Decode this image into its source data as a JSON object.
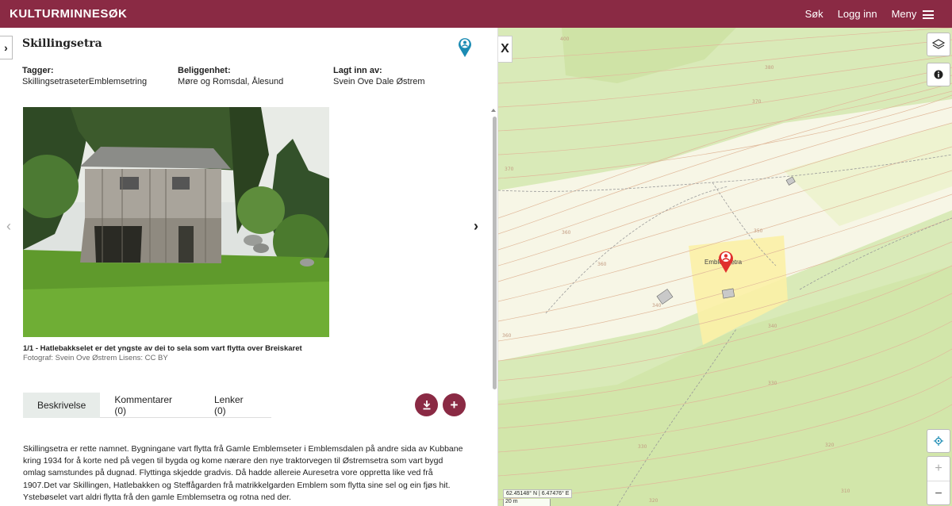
{
  "topbar": {
    "brand": "KULTURMINNESØK",
    "search_label": "Søk",
    "login_label": "Logg inn",
    "menu_label": "Meny",
    "bg_color": "#8a2a44"
  },
  "record": {
    "title": "Skillingsetra",
    "tags_label": "Tagger:",
    "tags_value": "SkillingsetraseterEmblemsetring",
    "location_label": "Beliggenhet:",
    "location_value": "Møre og Romsdal, Ålesund",
    "added_by_label": "Lagt inn av:",
    "added_by_value": "Svein Ove Dale Østrem"
  },
  "image": {
    "caption": "1/1 - Hatlebakkselet er det yngste av dei to sela som vart flytta over Breiskaret",
    "credit": "Fotograf: Svein Ove Østrem Lisens: CC BY"
  },
  "tabs": [
    {
      "label": "Beskrivelse",
      "active": true
    },
    {
      "label": "Kommentarer (0)",
      "active": false
    },
    {
      "label": "Lenker (0)",
      "active": false
    }
  ],
  "actions": {
    "download_icon": "download-icon",
    "add_icon": "plus-icon"
  },
  "description": "Skillingsetra er rette namnet. Bygningane vart flytta frå Gamle Emblemseter i Emblemsdalen på andre sida av Kubbane kring 1934 for å korte ned på vegen til bygda og kome nærare den nye traktorvegen til Østremsetra som vart bygd omlag samstundes på dugnad. Flyttinga skjedde gradvis. Då hadde allereie Auresetra vore oppretta like ved frå 1907.Det var Skillingen, Hatlebakken og Steffågarden frå matrikkelgarden Emblem som flytta sine sel og ein fjøs hit. Ystebøselet vart aldri flytta frå den gamle Emblemsetra og rotna ned der.",
  "map": {
    "site_label": "Emblemsetra",
    "coords": "62.45148° N | 6.47476° E",
    "scale": "20 m",
    "zoom_in": "+",
    "zoom_out": "−",
    "close": "X",
    "layers_icon": "layers-icon",
    "info_icon": "info-icon",
    "locate_icon": "locate-icon",
    "contour_labels": [
      "400",
      "390",
      "380",
      "370",
      "360",
      "350",
      "340",
      "330",
      "320"
    ]
  }
}
